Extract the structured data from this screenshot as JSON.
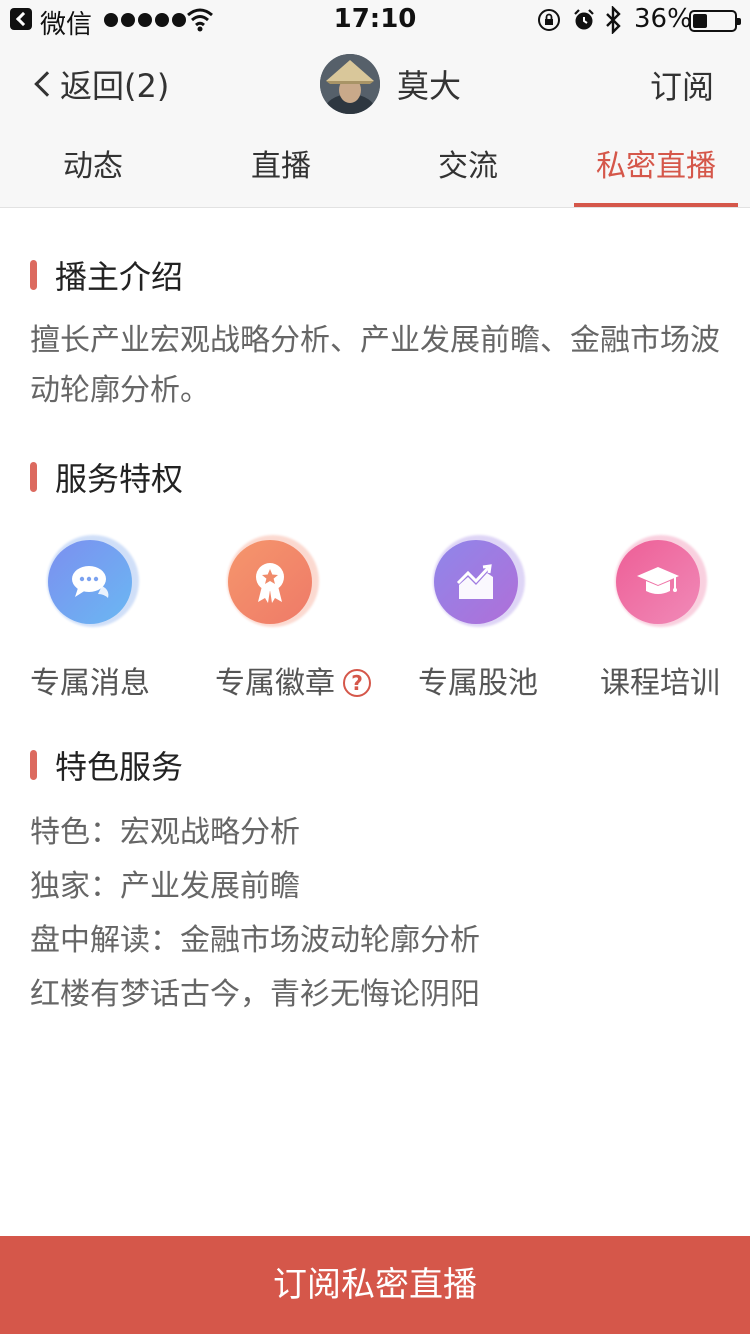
{
  "status_bar": {
    "carrier": "微信",
    "time": "17:10",
    "battery": "36%"
  },
  "nav": {
    "back_label": "返回(2)",
    "name": "莫大",
    "subscribe_label": "订阅"
  },
  "tabs": [
    {
      "label": "动态"
    },
    {
      "label": "直播"
    },
    {
      "label": "交流"
    },
    {
      "label": "私密直播",
      "active": true
    }
  ],
  "intro": {
    "title": "播主介绍",
    "text": "擅长产业宏观战略分析、产业发展前瞻、金融市场波动轮廓分析。"
  },
  "privileges": {
    "title": "服务特权",
    "items": [
      {
        "label": "专属消息",
        "icon": "chat-bubble-icon",
        "color": "#6a9ff0"
      },
      {
        "label": "专属徽章",
        "icon": "medal-badge-icon",
        "color": "#f08a6a",
        "help_glyph": "?"
      },
      {
        "label": "专属股池",
        "icon": "stock-chart-icon",
        "color": "#9b7ae6"
      },
      {
        "label": "课程培训",
        "icon": "graduation-cap-icon",
        "color": "#ec6aa2"
      }
    ]
  },
  "features": {
    "title": "特色服务",
    "lines": [
      "特色：宏观战略分析",
      "独家：产业发展前瞻",
      "盘中解读：金融市场波动轮廓分析",
      "红楼有梦话古今，青衫无悔论阴阳"
    ]
  },
  "cta": {
    "label": "订阅私密直播"
  },
  "colors": {
    "accent": "#d5574a",
    "section_bar": "#dc6a5f",
    "bar_background": "#f7f7f7"
  }
}
